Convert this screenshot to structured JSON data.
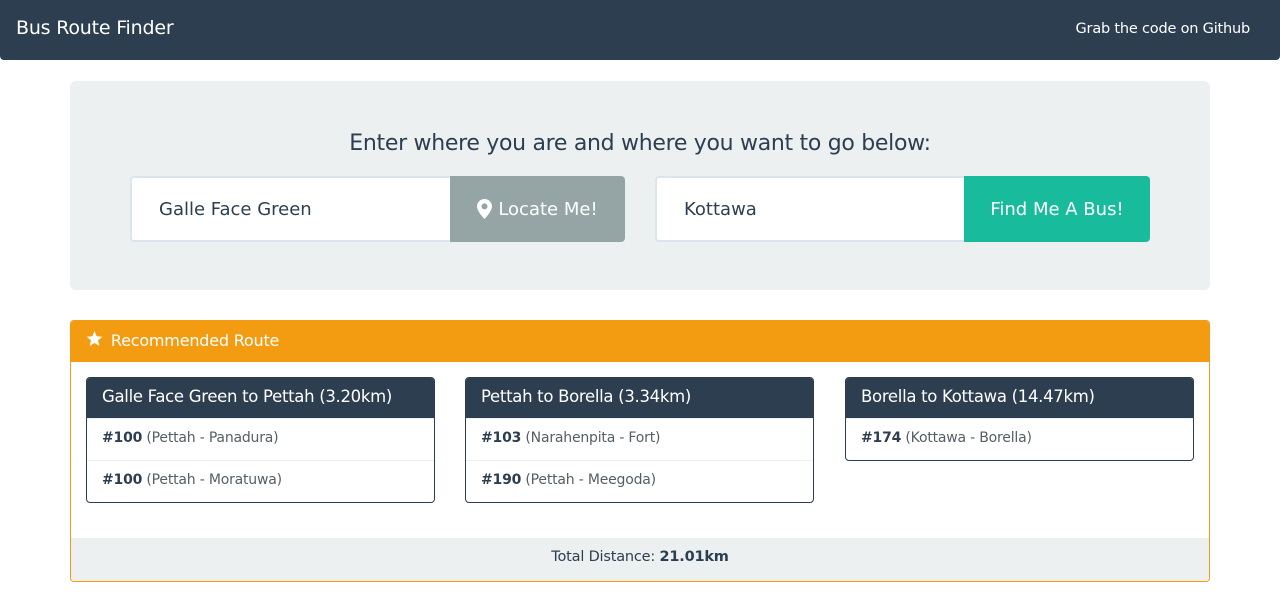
{
  "navbar": {
    "brand": "Bus Route Finder",
    "github_link": "Grab the code on Github"
  },
  "search": {
    "heading": "Enter where you are and where you want to go below:",
    "from_value": "Galle Face Green",
    "locate_label": "Locate Me!",
    "to_value": "Kottawa",
    "find_label": "Find Me A Bus!"
  },
  "route": {
    "heading": "Recommended Route",
    "legs": [
      {
        "title": "Galle Face Green to Pettah (3.20km)",
        "buses": [
          {
            "number": "#100",
            "desc": "(Pettah - Panadura)"
          },
          {
            "number": "#100",
            "desc": "(Pettah - Moratuwa)"
          }
        ]
      },
      {
        "title": "Pettah to Borella (3.34km)",
        "buses": [
          {
            "number": "#103",
            "desc": "(Narahenpita - Fort)"
          },
          {
            "number": "#190",
            "desc": "(Pettah - Meegoda)"
          }
        ]
      },
      {
        "title": "Borella to Kottawa (14.47km)",
        "buses": [
          {
            "number": "#174",
            "desc": "(Kottawa - Borella)"
          }
        ]
      }
    ],
    "total_label": "Total Distance:",
    "total_value": "21.01km"
  },
  "colors": {
    "navbar": "#2c3e50",
    "jumbotron": "#ecf0f1",
    "locate_button": "#95a5a6",
    "find_button": "#18bc9c",
    "panel_warning": "#f39c12"
  },
  "icons": {
    "locate": "map-marker-icon",
    "recommended": "star-icon"
  }
}
